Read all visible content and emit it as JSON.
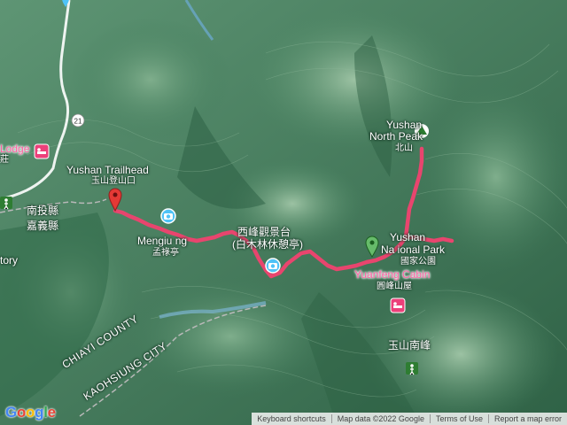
{
  "places": {
    "lodge": "Lodge",
    "lodge_zh": "莊",
    "nantou": "南投縣",
    "chiayi_zh": "嘉義縣",
    "story": "tory",
    "trailhead": "Yushan Trailhead",
    "trailhead_zh": "玉山登山口",
    "mengjiu": "Mengiu ng",
    "mengjiu_zh": "孟祿亭",
    "xifeng": "西峰觀景台",
    "xifeng2": "(白木林休憩亭)",
    "north_peak_1": "Yushan",
    "north_peak_2": "North Peak",
    "north_peak_zh": "北山",
    "yushan_np_1": "Yushan",
    "yushan_np_2": "Na ional Park",
    "yushan_np_zh": "國家公園",
    "yuanfeng": "Yuanfeng Cabin",
    "yuanfeng_zh": "圓峰山屋",
    "south_peak_zh": "玉山南峰",
    "chiayi_county": "CHIAYI COUNTY",
    "kaohsiung": "KAOHSIUNG CITY",
    "road_21": "21"
  },
  "footer": {
    "shortcuts": "Keyboard shortcuts",
    "mapdata": "Map data ©2022 Google",
    "terms": "Terms of Use",
    "report": "Report a map error"
  },
  "brand": {
    "google": "Google"
  },
  "colors": {
    "route": "#e8456e",
    "terrain": "#3f7a59",
    "pin_start": "#e53935",
    "pin_end": "#43a047"
  }
}
